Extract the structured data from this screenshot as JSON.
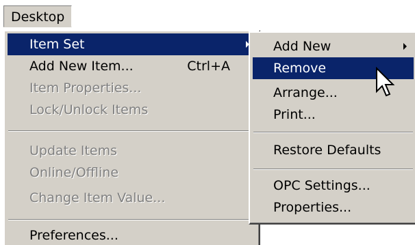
{
  "menubar": {
    "desktop_label": "Desktop"
  },
  "main_menu": {
    "items": [
      {
        "label": "Item Set",
        "shortcut": ""
      },
      {
        "label": "Add New Item...",
        "shortcut": "Ctrl+A"
      },
      {
        "label": "Item Properties..."
      },
      {
        "label": "Lock/Unlock Items"
      },
      {
        "label": "Update Items"
      },
      {
        "label": "Online/Offline"
      },
      {
        "label": "Change Item Value..."
      },
      {
        "label": "Preferences..."
      }
    ]
  },
  "sub_menu": {
    "items": [
      {
        "label": "Add New"
      },
      {
        "label": "Remove"
      },
      {
        "label": "Arrange..."
      },
      {
        "label": "Print..."
      },
      {
        "label": "Restore Defaults"
      },
      {
        "label": "OPC Settings..."
      },
      {
        "label": "Properties..."
      }
    ]
  },
  "colors": {
    "menu_background": "#d4d0c8",
    "highlight": "#0a246a",
    "disabled_text": "#808080"
  },
  "icons": {
    "submenu_arrow": "triangle-right",
    "cursor": "arrow-pointer"
  }
}
